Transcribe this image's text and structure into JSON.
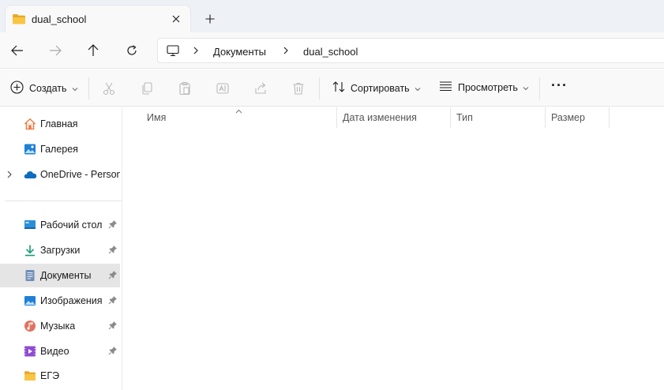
{
  "tab": {
    "title": "dual_school",
    "close_icon": "close-icon",
    "new_tab_icon": "plus-icon"
  },
  "nav": {
    "back_icon": "arrow-left-icon",
    "forward_icon": "arrow-right-icon",
    "up_icon": "arrow-up-icon",
    "refresh_icon": "refresh-icon"
  },
  "address": {
    "root_icon": "computer-icon",
    "crumbs": [
      "Документы",
      "dual_school"
    ]
  },
  "toolbar": {
    "create_label": "Создать",
    "sort_label": "Сортировать",
    "view_label": "Просмотреть",
    "more_label": "···",
    "disabled_actions": [
      "cut-icon",
      "copy-icon",
      "paste-icon",
      "rename-icon",
      "share-icon",
      "delete-icon"
    ]
  },
  "sidebar": {
    "top": [
      {
        "label": "Главная",
        "icon": "home-icon"
      },
      {
        "label": "Галерея",
        "icon": "gallery-icon"
      },
      {
        "label": "OneDrive - Persona",
        "icon": "onedrive-icon"
      }
    ],
    "pinned": [
      {
        "label": "Рабочий стол",
        "icon": "desktop-icon",
        "pinned": true
      },
      {
        "label": "Загрузки",
        "icon": "downloads-icon",
        "pinned": true
      },
      {
        "label": "Документы",
        "icon": "documents-icon",
        "pinned": true,
        "selected": true
      },
      {
        "label": "Изображения",
        "icon": "pictures-icon",
        "pinned": true
      },
      {
        "label": "Музыка",
        "icon": "music-icon",
        "pinned": true
      },
      {
        "label": "Видео",
        "icon": "video-icon",
        "pinned": true
      },
      {
        "label": "ЕГЭ",
        "icon": "folder-icon",
        "pinned": false
      }
    ]
  },
  "columns": {
    "name": "Имя",
    "modified": "Дата изменения",
    "type": "Тип",
    "size": "Размер"
  },
  "colors": {
    "accent": "#0067c0",
    "folder": "#f8c545",
    "selected_bg": "#e5e5e5"
  }
}
